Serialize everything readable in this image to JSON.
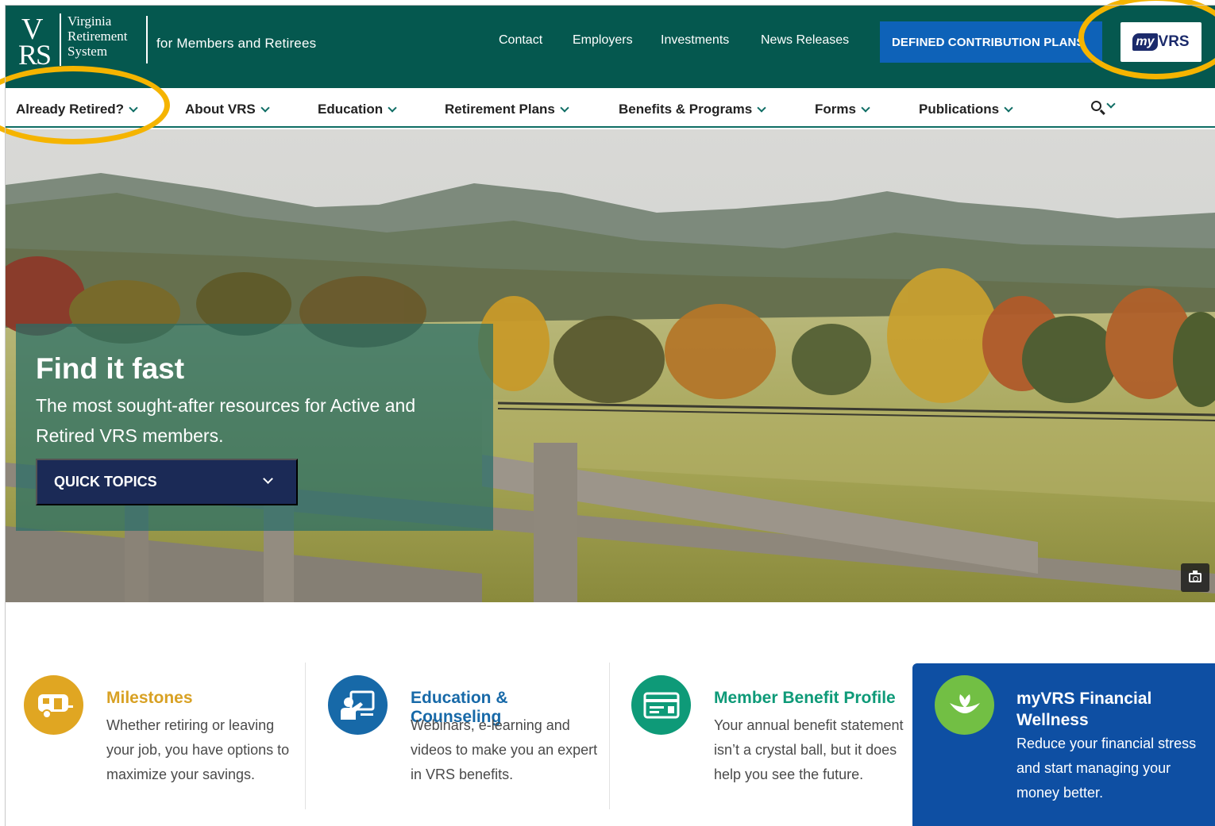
{
  "header": {
    "logo_lines": [
      "Virginia",
      "Retirement",
      "System"
    ],
    "logo_monogram": "VRS",
    "tagline": "for Members and Retirees",
    "utility_links": [
      "Contact",
      "Employers",
      "Investments",
      "News Releases"
    ],
    "dc_button_label": "DEFINED CONTRIBUTION PLANS",
    "myvrs_button": {
      "my": "my",
      "vrs": "VRS"
    }
  },
  "main_nav": {
    "items": [
      "Already Retired?",
      "About VRS",
      "Education",
      "Retirement Plans",
      "Benefits & Programs",
      "Forms",
      "Publications"
    ],
    "search_icon": "search-icon"
  },
  "hero": {
    "title": "Find it fast",
    "subtitle": "The most sought-after resources for Active and Retired VRS members.",
    "quick_topics_label": "QUICK TOPICS",
    "camera_icon": "camera-icon"
  },
  "cards": [
    {
      "title": "Milestones",
      "description": "Whether retiring or leaving your job, you have options to maximize your savings.",
      "icon": "camper-icon"
    },
    {
      "title": "Education & Counseling",
      "description": "Webinars, e-learning and videos to make you an expert in VRS benefits.",
      "icon": "presentation-icon"
    },
    {
      "title": "Member Benefit Profile",
      "description": "Your annual benefit statement isn’t a crystal ball, but it does help you see the future.",
      "icon": "statement-icon"
    },
    {
      "title": "myVRS Financial Wellness",
      "description": "Reduce your financial stress and start managing your money better.",
      "icon": "sprout-icon"
    }
  ],
  "colors": {
    "header_bg": "#05584f",
    "dc_button_bg": "#0e62b8",
    "highlight": "#f5b400",
    "milestones": "#e0a622",
    "education": "#1769a8",
    "member_profile": "#0e9a78",
    "wellness_card_bg": "#0e4fa3",
    "wellness_icon": "#72bf44"
  }
}
